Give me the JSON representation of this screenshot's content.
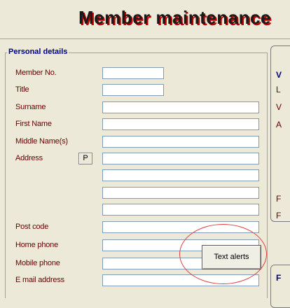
{
  "header": {
    "title": "Member maintenance"
  },
  "personal_details": {
    "legend": "Personal details",
    "fields": {
      "member_no": {
        "label": "Member No.",
        "value": ""
      },
      "title": {
        "label": "Title",
        "value": ""
      },
      "surname": {
        "label": "Surname",
        "value": ""
      },
      "first_name": {
        "label": "First Name",
        "value": ""
      },
      "middle_names": {
        "label": "Middle Name(s)",
        "value": ""
      },
      "address": {
        "label": "Address",
        "lines": [
          "",
          "",
          "",
          ""
        ]
      },
      "post_code": {
        "label": "Post code",
        "value": ""
      },
      "home_phone": {
        "label": "Home phone",
        "value": ""
      },
      "mobile_phone": {
        "label": "Mobile phone",
        "value": ""
      },
      "email": {
        "label": "E mail address",
        "value": ""
      }
    },
    "address_button": "P"
  },
  "right_panel": {
    "legend_partial": "V",
    "letters": [
      "L",
      "V",
      "A",
      "F",
      "F"
    ]
  },
  "right_panel_bottom": {
    "legend_partial": "F"
  },
  "text_alerts_button": "Text alerts",
  "highlight_color": "#e04040"
}
